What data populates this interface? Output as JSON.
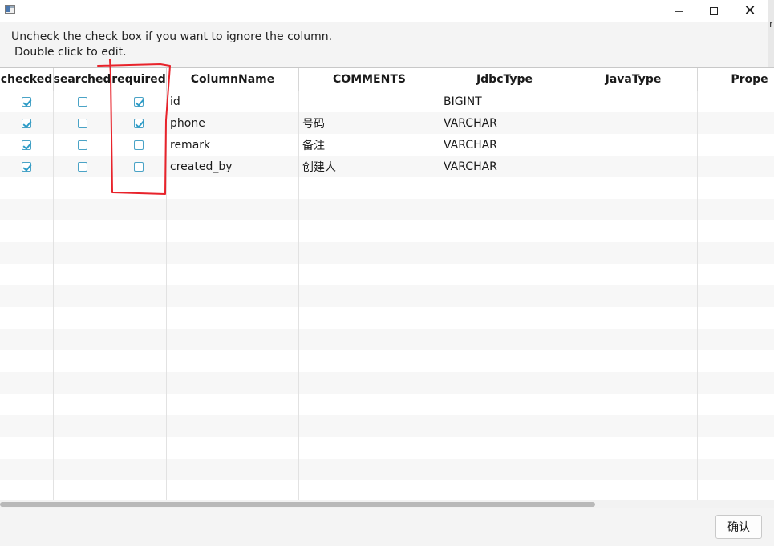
{
  "window": {
    "title": ""
  },
  "instructions": {
    "line1": "Uncheck the check box if you want to ignore the column.",
    "line2": "Double click to edit."
  },
  "table": {
    "columns": [
      "checked",
      "searched",
      "required",
      "ColumnName",
      "COMMENTS",
      "JdbcType",
      "JavaType",
      "Prope"
    ],
    "rows": [
      {
        "checked": true,
        "searched": false,
        "required": true,
        "column_name": "id",
        "comments": "",
        "jdbc_type": "BIGINT",
        "java_type": "",
        "property": ""
      },
      {
        "checked": true,
        "searched": false,
        "required": true,
        "column_name": "phone",
        "comments": "号码",
        "jdbc_type": "VARCHAR",
        "java_type": "",
        "property": ""
      },
      {
        "checked": true,
        "searched": false,
        "required": false,
        "column_name": "remark",
        "comments": "备注",
        "jdbc_type": "VARCHAR",
        "java_type": "",
        "property": ""
      },
      {
        "checked": true,
        "searched": false,
        "required": false,
        "column_name": "created_by",
        "comments": "创建人",
        "jdbc_type": "VARCHAR",
        "java_type": "",
        "property": ""
      }
    ],
    "empty_rows": 15
  },
  "footer": {
    "ok_label": "确认"
  },
  "edge_fragment": "r",
  "annotation": {
    "color": "#e8232b",
    "target": "required-column"
  },
  "colors": {
    "checkbox_accent": "#2e9cc7",
    "row_alt": "#f7f7f7"
  }
}
